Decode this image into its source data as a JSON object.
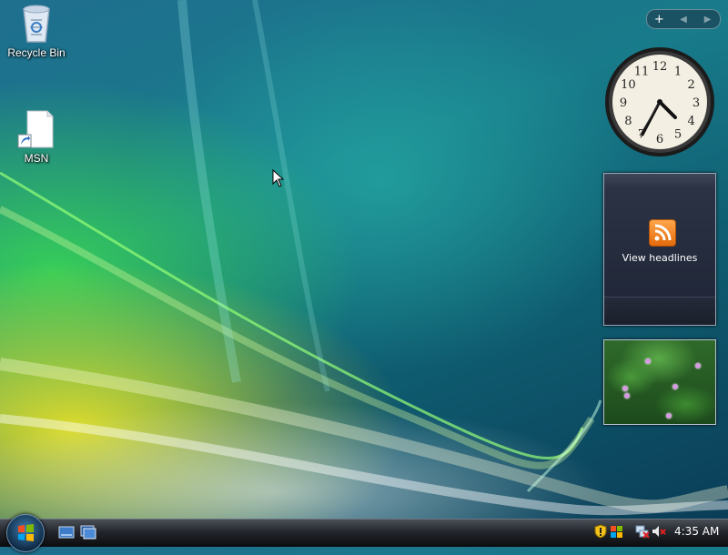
{
  "desktop": {
    "icons": [
      {
        "label": "Recycle Bin",
        "icon": "recycle-bin-icon"
      },
      {
        "label": "MSN",
        "icon": "shortcut-file-icon"
      }
    ]
  },
  "sidebar": {
    "controls": {
      "add": "+",
      "prev": "◀",
      "next": "▶"
    },
    "clock": {
      "numbers": [
        "12",
        "1",
        "2",
        "3",
        "4",
        "5",
        "6",
        "7",
        "8",
        "9",
        "10",
        "11"
      ],
      "time_shown": "4:35"
    },
    "feed_headlines": {
      "label": "View headlines",
      "icon": "rss-icon"
    },
    "slide_show": {
      "icon": "photo-slideshow"
    }
  },
  "taskbar": {
    "start_icon": "windows-orb-icon",
    "quick_launch": [
      "show-desktop-icon",
      "switch-windows-icon"
    ],
    "tray_icons": [
      "security-shield-icon",
      "windows-flag-icon",
      "network-disconnected-icon",
      "volume-muted-icon"
    ],
    "time": "4:35 AM"
  },
  "colors": {
    "taskbar": "#1a1c21",
    "rss_orange": "#f08a24",
    "wallpaper_teal": "#187b8a",
    "wallpaper_green": "#3cdc50",
    "wallpaper_yellow": "#e6e128"
  }
}
